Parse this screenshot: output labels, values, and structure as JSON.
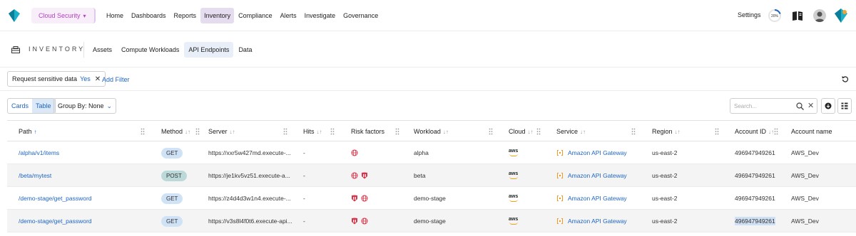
{
  "nav": {
    "product": "Cloud Security",
    "items": [
      "Home",
      "Dashboards",
      "Reports",
      "Inventory",
      "Compliance",
      "Alerts",
      "Investigate",
      "Governance"
    ],
    "active": "Inventory",
    "settings": "Settings",
    "progress": "20%",
    "progress_value": 0.2
  },
  "subheader": {
    "title": "INVENTORY",
    "tabs": [
      "Assets",
      "Compute Workloads",
      "API Endpoints",
      "Data"
    ],
    "active": "API Endpoints"
  },
  "filter": {
    "chip_label": "Request sensitive data",
    "chip_value": "Yes",
    "add_filter": "Add Filter"
  },
  "toolbar": {
    "cards": "Cards",
    "table": "Table",
    "group_by": "Group By: None",
    "search_placeholder": "Search..."
  },
  "table": {
    "columns": [
      "Path",
      "Method",
      "Server",
      "Hits",
      "Risk factors",
      "Workload",
      "Cloud",
      "Service",
      "Region",
      "Account ID",
      "Account name"
    ],
    "rows": [
      {
        "path": "/alpha/v1/items",
        "method": "GET",
        "server": "https://xxr5w427md.execute-...",
        "hits": "-",
        "risks": [
          "globe"
        ],
        "workload": "alpha",
        "cloud": "aws",
        "service": "Amazon API Gateway",
        "region": "us-east-2",
        "account_id": "496947949261",
        "account_name": "AWS_Dev"
      },
      {
        "path": "/beta/mytest",
        "method": "POST",
        "server": "https://je1kv5vz51.execute-a...",
        "hits": "-",
        "risks": [
          "globe",
          "shield"
        ],
        "workload": "beta",
        "cloud": "aws",
        "service": "Amazon API Gateway",
        "region": "us-east-2",
        "account_id": "496947949261",
        "account_name": "AWS_Dev"
      },
      {
        "path": "/demo-stage/get_password",
        "method": "GET",
        "server": "https://z4d4d3w1n4.execute-...",
        "hits": "-",
        "risks": [
          "shield",
          "globe"
        ],
        "workload": "demo-stage",
        "cloud": "aws",
        "service": "Amazon API Gateway",
        "region": "us-east-2",
        "account_id": "496947949261",
        "account_name": "AWS_Dev"
      },
      {
        "path": "/demo-stage/get_password",
        "method": "GET",
        "server": "https://v3s8l4f0t6.execute-api...",
        "hits": "-",
        "risks": [
          "shield",
          "globe"
        ],
        "workload": "demo-stage",
        "cloud": "aws",
        "service": "Amazon API Gateway",
        "region": "us-east-2",
        "account_id": "496947949261",
        "account_name": "AWS_Dev"
      }
    ]
  },
  "colors": {
    "accent": "#1f66c1",
    "brand_purple": "#b63fc7",
    "risk_red": "#d9344a",
    "aws_orange": "#f39b1d"
  },
  "icons": [
    "app-logo-icon",
    "chevron-down-icon",
    "progress-ring-icon",
    "book-icon",
    "avatar",
    "app-switch-icon",
    "inventory-icon",
    "close-icon",
    "reset-icon",
    "search-icon",
    "download-icon",
    "columns-icon",
    "drag-handle-icon",
    "globe-icon",
    "shield-icon",
    "aws-logo-icon",
    "api-gateway-icon"
  ]
}
